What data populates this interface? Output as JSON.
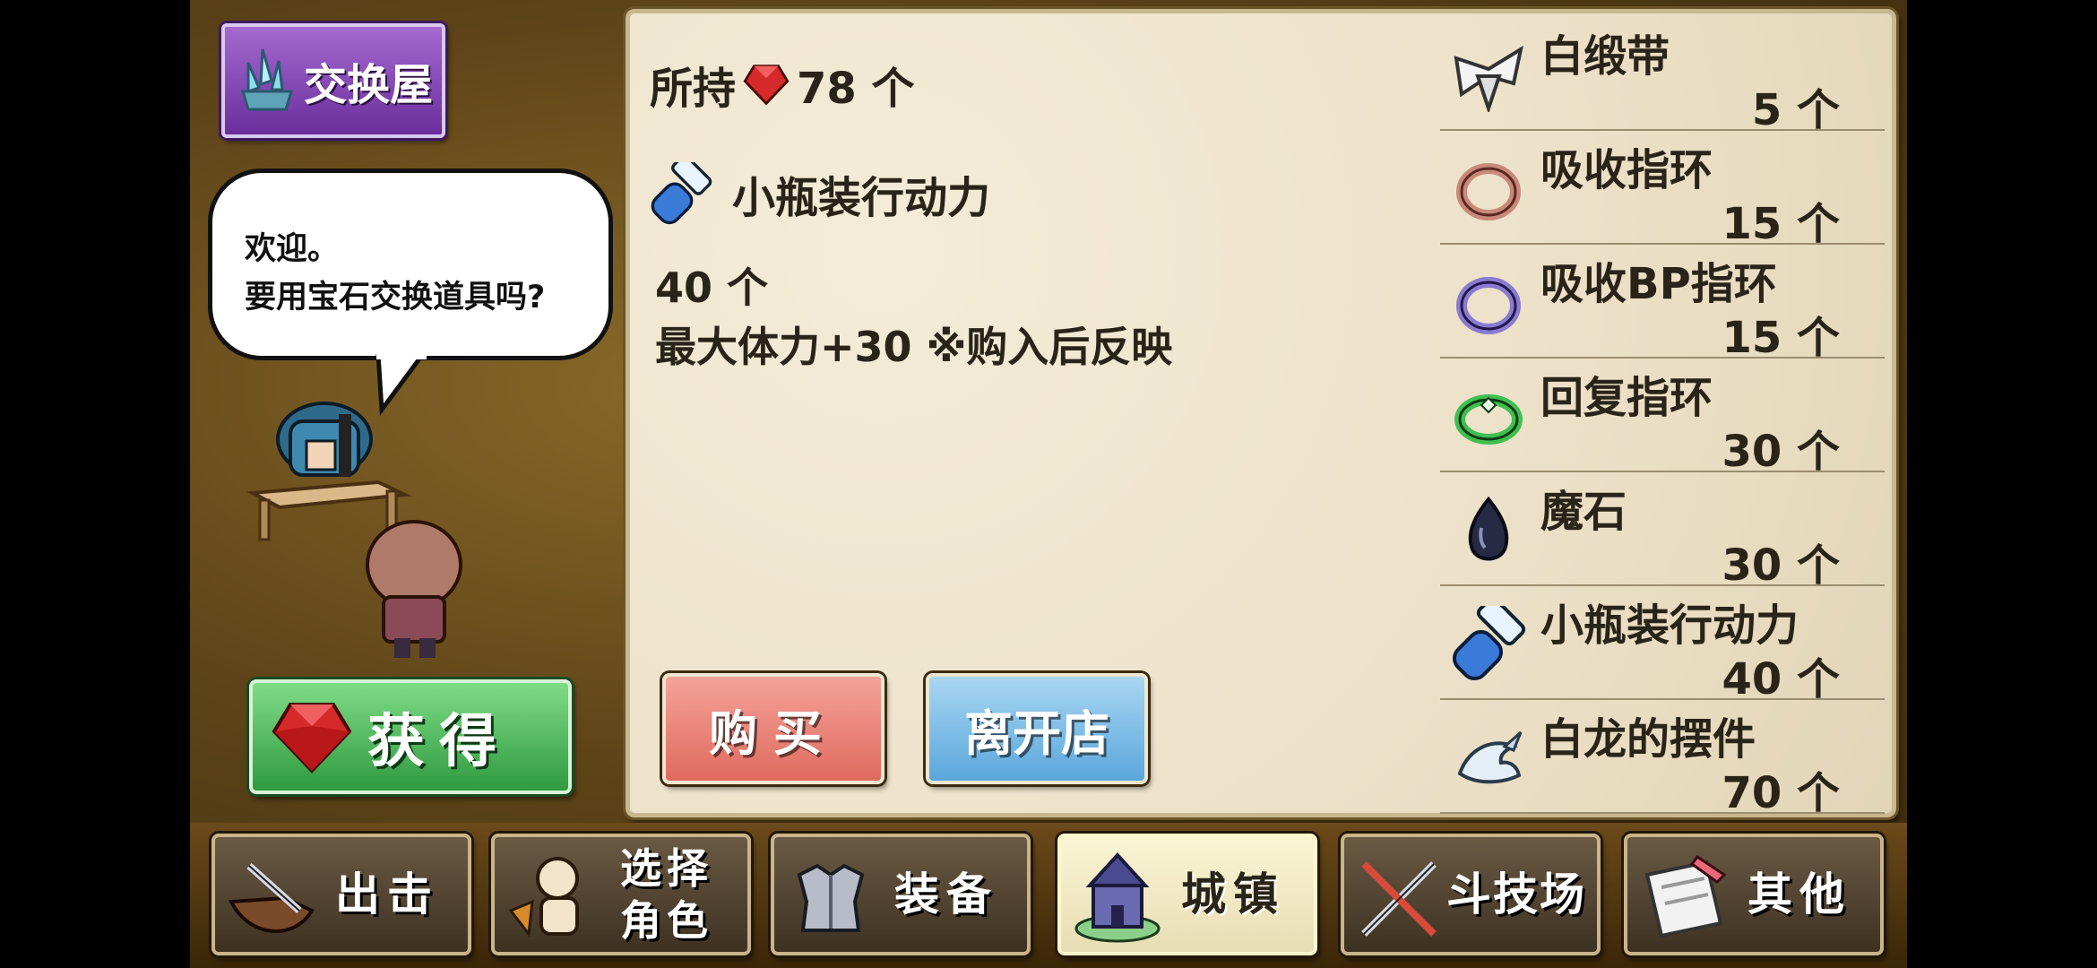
{
  "shop": {
    "title": "交换屋"
  },
  "npc": {
    "line1": "欢迎。",
    "line2": "要用宝石交换道具吗?"
  },
  "get_button": {
    "label": "获得"
  },
  "wallet": {
    "prefix": "所持",
    "amount_text": "78 个"
  },
  "selected_item": {
    "name": "小瓶装行动力",
    "qty_text": "40 个",
    "description": "最大体力+30 ※购入后反映"
  },
  "actions": {
    "buy_label": "购买",
    "leave_label": "离开店"
  },
  "items": [
    {
      "name": "白缎带",
      "count": "5 个",
      "icon": "white-ribbon-icon"
    },
    {
      "name": "吸收指环",
      "count": "15 个",
      "icon": "red-ring-icon"
    },
    {
      "name": "吸收BP指环",
      "count": "15 个",
      "icon": "purple-ring-icon"
    },
    {
      "name": "回复指环",
      "count": "30 个",
      "icon": "green-ring-icon"
    },
    {
      "name": "魔石",
      "count": "30 个",
      "icon": "dark-stone-icon"
    },
    {
      "name": "小瓶装行动力",
      "count": "40 个",
      "icon": "blue-vial-icon"
    },
    {
      "name": "白龙的摆件",
      "count": "70 个",
      "icon": "white-dragon-icon"
    }
  ],
  "nav": [
    {
      "label": "出击",
      "icon": "boat-icon"
    },
    {
      "label": "选择\n角色",
      "icon": "character-icon"
    },
    {
      "label": "装备",
      "icon": "armor-icon"
    },
    {
      "label": "城镇",
      "icon": "castle-icon",
      "active": true
    },
    {
      "label": "斗技场",
      "icon": "swords-icon"
    },
    {
      "label": "其他",
      "icon": "scroll-icon"
    }
  ],
  "colors": {
    "buy": "#e06a5e",
    "leave": "#5aa7dc",
    "get": "#2f9a3f",
    "shop_title": "#6a2e9c"
  }
}
